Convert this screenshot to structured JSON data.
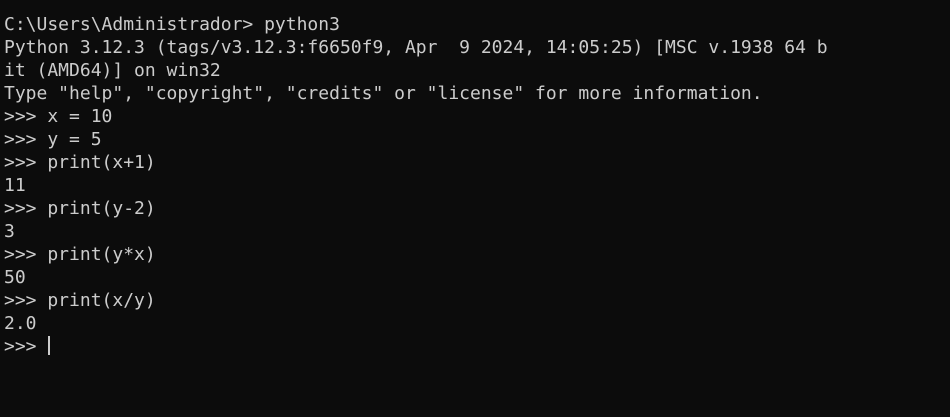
{
  "terminal": {
    "lines": [
      "C:\\Users\\Administrador> python3",
      "Python 3.12.3 (tags/v3.12.3:f6650f9, Apr  9 2024, 14:05:25) [MSC v.1938 64 b",
      "it (AMD64)] on win32",
      "Type \"help\", \"copyright\", \"credits\" or \"license\" for more information.",
      ">>> x = 10",
      ">>> y = 5",
      ">>> print(x+1)",
      "11",
      ">>> print(y-2)",
      "3",
      ">>> print(y*x)",
      "50",
      ">>> print(x/y)",
      "2.0"
    ],
    "active_prompt": ">>> ",
    "colors": {
      "background": "#0c0c0c",
      "foreground": "#cccccc"
    }
  }
}
